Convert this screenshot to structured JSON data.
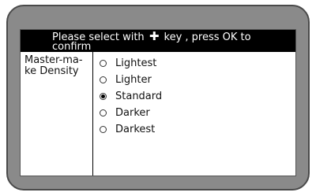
{
  "header": {
    "line1_prefix": "Please select with",
    "line1_suffix": "key , press OK to",
    "line2": "confirm",
    "key_icon": "plus-icon"
  },
  "setting": {
    "label": "Master-ma-ke Density"
  },
  "options": [
    {
      "label": "Lightest",
      "selected": false
    },
    {
      "label": "Lighter",
      "selected": false
    },
    {
      "label": "Standard",
      "selected": true
    },
    {
      "label": "Darker",
      "selected": false
    },
    {
      "label": "Darkest",
      "selected": false
    }
  ],
  "colors": {
    "bezel": "#8a8a8a",
    "header_bg": "#000000",
    "header_text": "#ffffff"
  }
}
